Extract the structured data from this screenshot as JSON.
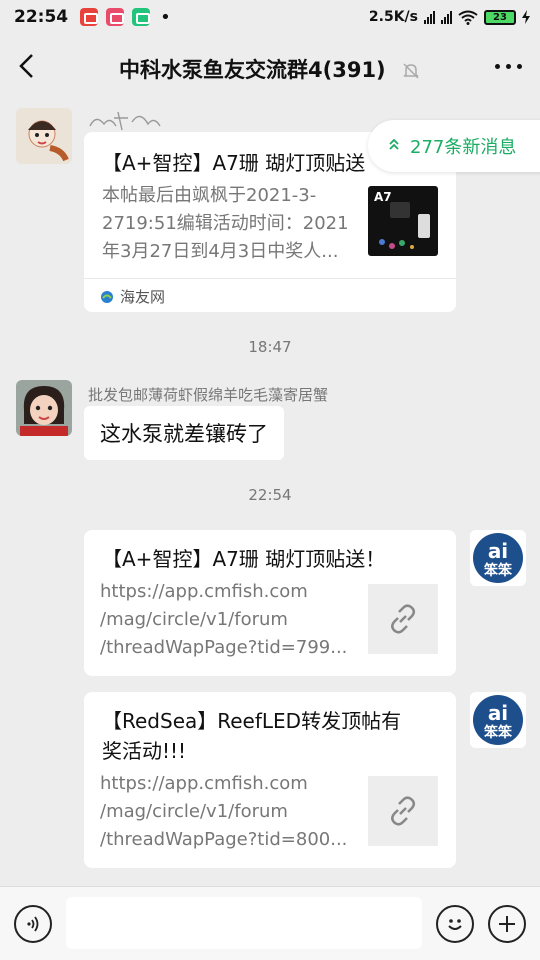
{
  "status_bar": {
    "time": "22:54",
    "app_icons": [
      "album-app-icon",
      "pinduoduo-app-icon",
      "shield-app-icon"
    ],
    "dot": "•",
    "network_speed": "2.5K/s",
    "battery": "23"
  },
  "header": {
    "title": "中科水泵鱼友交流群4(391)",
    "back_icon": "back-arrow-icon",
    "mute_icon": "bell-off-icon",
    "more_icon": "more-dots-icon"
  },
  "new_messages": {
    "label": "277条新消息",
    "icon": "double-chevron-up-icon"
  },
  "messages": [
    {
      "type": "card",
      "title": "【A+智控】A7珊 瑚灯顶贴送",
      "desc_lines": [
        "本帖最后由飒枫于2021-3-",
        "2719:51编辑活动时间：2021",
        "年3月27日到4月3日中奖人..."
      ],
      "thumb_label": "A7",
      "source": "海友网"
    },
    {
      "type": "time",
      "text": "18:47"
    },
    {
      "type": "text",
      "sender": "批发包邮薄荷虾假绵羊吃毛藻寄居蟹",
      "text": "这水泵就差镶砖了"
    },
    {
      "type": "time",
      "text": "22:54"
    },
    {
      "type": "link",
      "title": "【A+智控】A7珊 瑚灯顶贴送！",
      "url_lines": [
        "https://app.cmfish.com",
        "/mag/circle/v1/forum",
        "/threadWapPage?tid=799..."
      ]
    },
    {
      "type": "link",
      "title_lines": [
        "【RedSea】ReefLED转发顶帖有",
        "奖活动!!!"
      ],
      "url_lines": [
        "https://app.cmfish.com",
        "/mag/circle/v1/forum",
        "/threadWapPage?tid=800..."
      ]
    }
  ],
  "my_avatar_text": "笨笨",
  "input_bar": {
    "voice_icon": "voice-icon",
    "emoji_icon": "emoji-icon",
    "plus_icon": "plus-icon",
    "placeholder": ""
  },
  "colors": {
    "accent_green": "#1aad63",
    "background": "#ededed"
  }
}
